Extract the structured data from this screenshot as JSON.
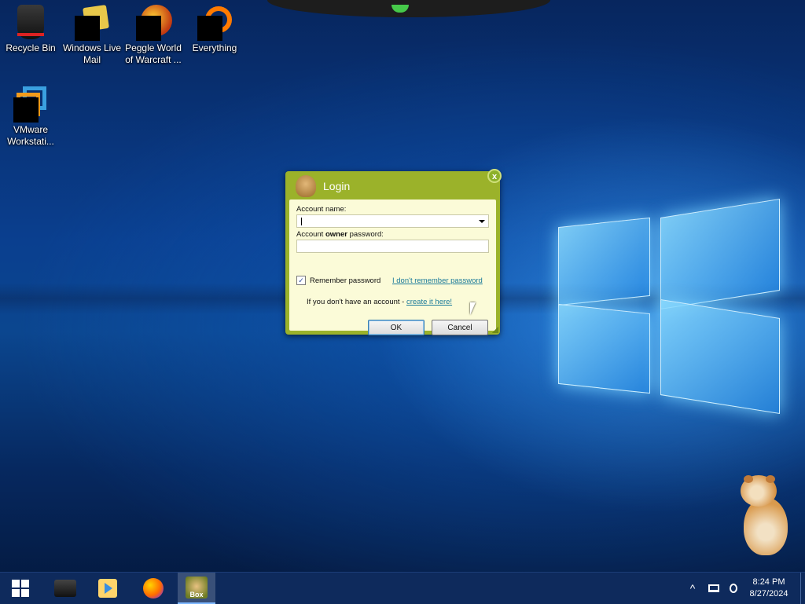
{
  "desktop": {
    "icons": [
      {
        "label": "Recycle Bin",
        "icon": "recycle-bin-icon"
      },
      {
        "label": "Windows Live Mail",
        "icon": "mail-icon"
      },
      {
        "label": "Peggle World of Warcraft ...",
        "icon": "peggle-icon"
      },
      {
        "label": "Everything",
        "icon": "everything-search-icon"
      },
      {
        "label": "VMware Workstati...",
        "icon": "vmware-icon"
      }
    ]
  },
  "dialog": {
    "title": "Login",
    "close_label": "x",
    "account_name_label": "Account name:",
    "account_name_value": "",
    "password_label_prefix": "Account ",
    "password_label_bold": "owner",
    "password_label_suffix": " password:",
    "password_value": "",
    "remember_password_label": "Remember password",
    "remember_password_checked": true,
    "forgot_link": "I don't remember password",
    "no_account_text": "If you don't have an account - ",
    "create_link": "create it here!",
    "ok_label": "OK",
    "cancel_label": "Cancel",
    "accent_color": "#9bb22a"
  },
  "taskbar": {
    "pinned": [
      {
        "name": "start",
        "icon": "windows-start-icon"
      },
      {
        "name": "dark-app",
        "icon": "black-box-icon"
      },
      {
        "name": "media-player",
        "icon": "media-player-icon"
      },
      {
        "name": "firefox",
        "icon": "firefox-icon"
      },
      {
        "name": "bonzi-box",
        "icon": "hamster-box-icon",
        "label": "Box",
        "active": true
      }
    ],
    "tray": {
      "chevron": "^",
      "time": "8:24 PM",
      "date": "8/27/2024"
    }
  }
}
